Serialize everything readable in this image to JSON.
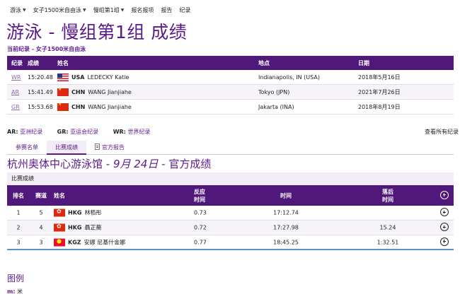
{
  "nav": {
    "items": [
      {
        "label": "游泳",
        "dropdown": true
      },
      {
        "label": "女子1500米自由泳",
        "dropdown": true
      },
      {
        "label": "慢组第1组",
        "dropdown": true
      },
      {
        "label": "报名报项",
        "dropdown": false
      },
      {
        "label": "报告",
        "dropdown": false
      },
      {
        "label": "纪录",
        "dropdown": false
      }
    ]
  },
  "page": {
    "title": "游泳 - 慢组第1组 成绩",
    "current_record": "当前纪录 - 女子1500米自由泳"
  },
  "records": {
    "headers": {
      "code": "纪录",
      "time": "成绩",
      "name": "姓名",
      "location": "地点",
      "date": "日期"
    },
    "rows": [
      {
        "code": "WR",
        "time": "15:20.48",
        "flag": "usa",
        "noc": "USA",
        "name": "LEDECKY Katie",
        "location": "Indianapolis, IN (USA)",
        "date": "2018年5月16日"
      },
      {
        "code": "AR",
        "time": "15:41.49",
        "flag": "chn",
        "noc": "CHN",
        "name": "WANG Jianjiahe",
        "location": "Tokyo (JPN)",
        "date": "2021年7月26日"
      },
      {
        "code": "GR",
        "time": "15:53.68",
        "flag": "chn",
        "noc": "CHN",
        "name": "WANG Jianjiahe",
        "location": "Jakarta (INA)",
        "date": "2018年8月19日"
      }
    ]
  },
  "legend_abbr": [
    {
      "code": "AR:",
      "text": "亚洲纪录"
    },
    {
      "code": "GR:",
      "text": "亚运会纪录"
    },
    {
      "code": "WR:",
      "text": "世界纪录"
    }
  ],
  "view_all_records": "查看所有纪录",
  "tabs": [
    {
      "label": "参赛名单",
      "active": false,
      "icon": ""
    },
    {
      "label": "比赛成绩",
      "active": true,
      "icon": ""
    },
    {
      "label": "官方报告",
      "active": false,
      "icon": "document-icon"
    }
  ],
  "venue": {
    "name": "杭州奥体中心游泳馆",
    "sep1": " - ",
    "date": "9月 24日",
    "sep2": " - ",
    "suffix": "官方成绩"
  },
  "results": {
    "band": "比赛成绩",
    "headers": {
      "rank": "排名",
      "lane": "赛道",
      "name": "姓名",
      "react_1": "反应",
      "react_2": "时间",
      "time": "时间",
      "behind_1": "落后",
      "behind_2": "时间"
    },
    "rows": [
      {
        "rank": "1",
        "lane": "5",
        "flag": "hkg",
        "noc": "HKG",
        "name": "林栢彤",
        "reaction": "0.73",
        "time": "17:12.74",
        "behind": ""
      },
      {
        "rank": "2",
        "lane": "4",
        "flag": "hkg",
        "noc": "HKG",
        "name": "聶芷蕎",
        "reaction": "0.72",
        "time": "17:27.98",
        "behind": "15.24"
      },
      {
        "rank": "3",
        "lane": "3",
        "flag": "kgz",
        "noc": "KGZ",
        "name": "安娜 尼基什金娜",
        "reaction": "0.77",
        "time": "18:45.25",
        "behind": "1:32.51"
      }
    ]
  },
  "legend": {
    "title": "图例",
    "m_code": "m:",
    "m_text": "米"
  }
}
